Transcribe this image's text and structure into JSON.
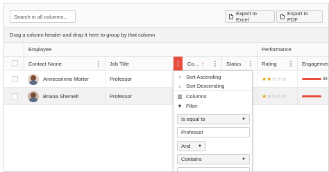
{
  "toolbar": {
    "search_placeholder": "Search in all columns...",
    "export_excel": "Export to Excel",
    "export_pdf": "Export to PDF"
  },
  "group_panel": {
    "text": "Drag a column header and drop it here to group by that column"
  },
  "header": {
    "bands": {
      "employee": "Employee",
      "performance": "Performance"
    },
    "columns": {
      "contact_name": "Contact Name",
      "job_title": "Job Title",
      "country": "Co...",
      "status": "Status",
      "rating": "Rating",
      "engagement": "Engagement"
    },
    "sort_indicator": "↑",
    "kebab": "⋮"
  },
  "rows": [
    {
      "name": "Annecorinne Morter",
      "job_title": "Professor",
      "rating": 2,
      "rating_max": 5,
      "engagement_text": "38"
    },
    {
      "name": "Briana Shemelt",
      "job_title": "Professor",
      "rating": 1,
      "rating_max": 5
    }
  ],
  "column_menu": {
    "sort_ascending": "Sort Ascending",
    "sort_descending": "Sort Descending",
    "columns": "Columns",
    "filter": "Filter",
    "operator_1": "Is equal to",
    "value_1": "Professor",
    "logic": "And",
    "operator_2": "Contains",
    "value_2": ""
  },
  "colors": {
    "accent": "#e84c3d",
    "star": "#d9a400"
  }
}
